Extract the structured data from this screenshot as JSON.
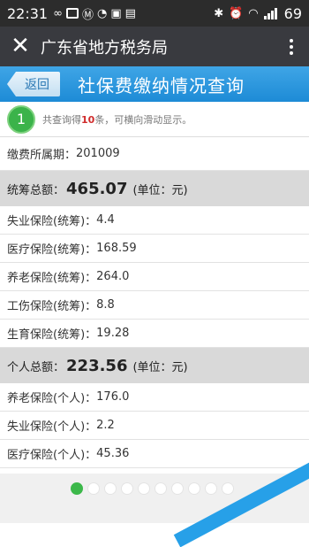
{
  "status_bar": {
    "time": "22:31",
    "battery": "69",
    "icons_left": [
      "infinity-icon",
      "image-icon",
      "m-icon",
      "refresh-icon",
      "app-icon",
      "sd-icon"
    ],
    "icons_right": [
      "bluetooth-icon",
      "alarm-icon",
      "wifi-icon",
      "signal-icon"
    ]
  },
  "titlebar": {
    "close_glyph": "✕",
    "title": "广东省地方税务局"
  },
  "page_header": {
    "back_label": "返回",
    "title": "社保费缴纳情况查询"
  },
  "notice": {
    "badge_number": "1",
    "text_before": "共查询得",
    "count": "10",
    "text_after": "条，可横向滑动显示。"
  },
  "period": {
    "label": "缴费所属期：",
    "value": "201009"
  },
  "overall_summary": {
    "label": "统筹总额：",
    "amount": "465.07",
    "unit": "(单位：元)"
  },
  "overall_items": [
    {
      "label": "失业保险(统筹)：",
      "value": "4.4"
    },
    {
      "label": "医疗保险(统筹)：",
      "value": "168.59"
    },
    {
      "label": "养老保险(统筹)：",
      "value": "264.0"
    },
    {
      "label": "工伤保险(统筹)：",
      "value": "8.8"
    },
    {
      "label": "生育保险(统筹)：",
      "value": "19.28"
    }
  ],
  "personal_summary": {
    "label": "个人总额：",
    "amount": "223.56",
    "unit": "(单位：元)"
  },
  "personal_items": [
    {
      "label": "养老保险(个人)：",
      "value": "176.0"
    },
    {
      "label": "失业保险(个人)：",
      "value": "2.2"
    },
    {
      "label": "医疗保险(个人)：",
      "value": "45.36"
    }
  ],
  "pager": {
    "total": 10,
    "active_index": 0
  },
  "colors": {
    "accent": "#1d8bd6",
    "badge": "#3bb34a",
    "count": "#d02b2b"
  }
}
